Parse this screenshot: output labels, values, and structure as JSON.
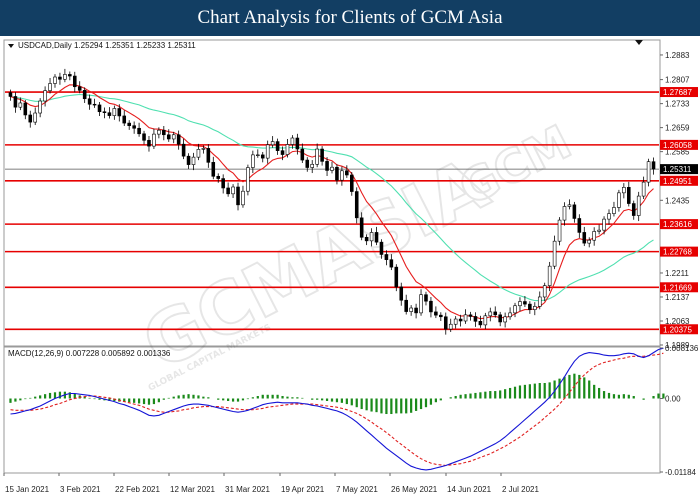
{
  "header": {
    "title": "Chart Analysis for Clients of GCM Asia"
  },
  "chart_data": [
    {
      "type": "candlestick",
      "symbol_label": "USDCAD,Daily  1.25294 1.25351 1.25233 1.25311",
      "ylim": [
        1.1989,
        1.2926
      ],
      "y_ticks": [
        1.2883,
        1.2807,
        1.2733,
        1.2659,
        1.2585,
        1.2435,
        1.2362,
        1.2211,
        1.2137,
        1.2063,
        1.1989
      ],
      "x_ticks": [
        "15 Jan 2021",
        "3 Feb 2021",
        "22 Feb 2021",
        "12 Mar 2021",
        "31 Mar 2021",
        "19 Apr 2021",
        "7 May 2021",
        "26 May 2021",
        "14 Jun 2021",
        "2 Jul 2021"
      ],
      "levels": [
        {
          "value": 1.27687,
          "label": "1.27687"
        },
        {
          "value": 1.26058,
          "label": "1.26058"
        },
        {
          "value": 1.24951,
          "label": "1.24951"
        },
        {
          "value": 1.23616,
          "label": "1.23616"
        },
        {
          "value": 1.22768,
          "label": "1.22768"
        },
        {
          "value": 1.21669,
          "label": "1.21669"
        },
        {
          "value": 1.20375,
          "label": "1.20375"
        }
      ],
      "current_price": {
        "value": 1.25311,
        "label": "1.25311"
      },
      "level_color": "#e60000",
      "fast_ma_color": "#e61e1e",
      "slow_ma_color": "#4fe0b0",
      "candle_up_color": "#000000",
      "candle_down_color": "#000000",
      "closes": [
        1.2755,
        1.2722,
        1.2735,
        1.2698,
        1.2676,
        1.2704,
        1.2741,
        1.2773,
        1.2795,
        1.2815,
        1.2808,
        1.2823,
        1.2818,
        1.2785,
        1.2774,
        1.2748,
        1.2731,
        1.2729,
        1.2708,
        1.2705,
        1.2696,
        1.2718,
        1.2695,
        1.2673,
        1.2665,
        1.2657,
        1.264,
        1.262,
        1.2602,
        1.2639,
        1.2651,
        1.2637,
        1.2624,
        1.2637,
        1.2608,
        1.2571,
        1.2545,
        1.2568,
        1.2592,
        1.2595,
        1.2552,
        1.2509,
        1.2502,
        1.2473,
        1.2455,
        1.2476,
        1.2421,
        1.2463,
        1.2536,
        1.2575,
        1.2575,
        1.2565,
        1.2606,
        1.2616,
        1.2588,
        1.2576,
        1.2607,
        1.2627,
        1.2593,
        1.2559,
        1.2536,
        1.2546,
        1.2593,
        1.2555,
        1.2527,
        1.2537,
        1.2497,
        1.2526,
        1.2513,
        1.2462,
        1.2381,
        1.2321,
        1.231,
        1.2336,
        1.2306,
        1.2268,
        1.2252,
        1.2229,
        1.2168,
        1.2127,
        1.2092,
        1.2103,
        1.2088,
        1.2144,
        1.2124,
        1.2091,
        1.2081,
        1.2076,
        1.2038,
        1.2053,
        1.2069,
        1.2063,
        1.2082,
        1.2077,
        1.2062,
        1.2051,
        1.2079,
        1.2091,
        1.2082,
        1.206,
        1.2076,
        1.2088,
        1.211,
        1.2123,
        1.2115,
        1.2098,
        1.2108,
        1.2137,
        1.2172,
        1.2232,
        1.2309,
        1.2374,
        1.2416,
        1.2421,
        1.2379,
        1.2336,
        1.2303,
        1.2312,
        1.2339,
        1.2343,
        1.2377,
        1.2394,
        1.2413,
        1.2458,
        1.2475,
        1.2425,
        1.2388,
        1.2448,
        1.2491,
        1.2554,
        1.2531
      ],
      "fast_ma": [
        1.2755,
        1.2749,
        1.2746,
        1.2738,
        1.2728,
        1.2724,
        1.2727,
        1.2736,
        1.2748,
        1.2762,
        1.2772,
        1.2783,
        1.2791,
        1.279,
        1.2787,
        1.278,
        1.2771,
        1.2763,
        1.2752,
        1.2743,
        1.2734,
        1.2731,
        1.2724,
        1.2714,
        1.2705,
        1.2696,
        1.2686,
        1.2673,
        1.2659,
        1.2655,
        1.2654,
        1.2651,
        1.2646,
        1.2644,
        1.2637,
        1.2626,
        1.2612,
        1.2604,
        1.2602,
        1.2601,
        1.2592,
        1.2577,
        1.2564,
        1.2546,
        1.2529,
        1.2519,
        1.2501,
        1.2492,
        1.25,
        1.2514,
        1.2525,
        1.2533,
        1.2546,
        1.2559,
        1.2564,
        1.2566,
        1.2575,
        1.2585,
        1.2587,
        1.2582,
        1.2573,
        1.2568,
        1.2573,
        1.2569,
        1.2561,
        1.2557,
        1.2544,
        1.254,
        1.2534,
        1.2517,
        1.249,
        1.2458,
        1.2431,
        1.2413,
        1.2393,
        1.2369,
        1.2348,
        1.2326,
        1.2295,
        1.2263,
        1.2231,
        1.2207,
        1.2184,
        1.2175,
        1.2163,
        1.2148,
        1.2133,
        1.212,
        1.2103,
        1.2092,
        1.2085,
        1.2078,
        1.2079,
        1.2079,
        1.2075,
        1.207,
        1.2072,
        1.2076,
        1.2077,
        1.2073,
        1.2074,
        1.2077,
        1.2085,
        1.2093,
        1.2098,
        1.2098,
        1.21,
        1.2108,
        1.212,
        1.2145,
        1.2181,
        1.2224,
        1.2265,
        1.2297,
        1.2312,
        1.2317,
        1.2313,
        1.2313,
        1.2319,
        1.2324,
        1.2336,
        1.235,
        1.2364,
        1.2384,
        1.2403,
        1.2407,
        1.2401,
        1.2413,
        1.2431,
        1.2457,
        1.2471
      ],
      "slow_ma": [
        1.2755,
        1.2752,
        1.275,
        1.2747,
        1.2743,
        1.274,
        1.274,
        1.2742,
        1.2745,
        1.2749,
        1.2752,
        1.2756,
        1.2758,
        1.276,
        1.2761,
        1.276,
        1.2759,
        1.2757,
        1.2755,
        1.2752,
        1.2749,
        1.2748,
        1.2745,
        1.2741,
        1.2737,
        1.2733,
        1.2729,
        1.2723,
        1.2717,
        1.2713,
        1.271,
        1.2706,
        1.2702,
        1.2699,
        1.2694,
        1.2688,
        1.268,
        1.2675,
        1.2671,
        1.2667,
        1.2661,
        1.2653,
        1.2646,
        1.2637,
        1.2628,
        1.262,
        1.261,
        1.2603,
        1.26,
        1.2599,
        1.2597,
        1.2596,
        1.2596,
        1.2597,
        1.2597,
        1.2596,
        1.2597,
        1.2598,
        1.2598,
        1.2596,
        1.2593,
        1.2591,
        1.2592,
        1.259,
        1.2587,
        1.2584,
        1.258,
        1.2577,
        1.2574,
        1.2569,
        1.2559,
        1.2548,
        1.2537,
        1.2528,
        1.2517,
        1.2505,
        1.2492,
        1.2479,
        1.2463,
        1.2446,
        1.2427,
        1.241,
        1.2393,
        1.238,
        1.2365,
        1.2349,
        1.2333,
        1.2317,
        1.23,
        1.2285,
        1.227,
        1.2256,
        1.2243,
        1.2231,
        1.2219,
        1.2206,
        1.2196,
        1.2186,
        1.2177,
        1.2167,
        1.2159,
        1.2152,
        1.2146,
        1.2141,
        1.2136,
        1.213,
        1.2126,
        1.2126,
        1.2127,
        1.2132,
        1.214,
        1.2151,
        1.2163,
        1.2175,
        1.2183,
        1.219,
        1.2195,
        1.22,
        1.2206,
        1.2212,
        1.222,
        1.2229,
        1.2238,
        1.2249,
        1.226,
        1.2267,
        1.2272,
        1.228,
        1.229,
        1.2303,
        1.2313
      ]
    },
    {
      "type": "macd",
      "indicator_label": "MACD(12,26,9) 0.007228 0.005892 0.001336",
      "ylim": [
        -0.01184,
        0.008136
      ],
      "y_ticks": [
        0.008136,
        0.0,
        -0.01184
      ],
      "y_tick_labels": [
        "0.008136",
        "0.00",
        "-0.01184"
      ],
      "macd_color": "#1515d6",
      "signal_color": "#e02020",
      "hist_color": "#1a8a1a",
      "macd": [
        -0.0025,
        -0.0024,
        -0.0022,
        -0.002,
        -0.0018,
        -0.0015,
        -0.0012,
        -0.0008,
        -0.0004,
        0.0,
        0.0003,
        0.0006,
        0.0008,
        0.0008,
        0.0007,
        0.0006,
        0.0005,
        0.0003,
        0.0001,
        -0.0001,
        -0.0003,
        -0.0005,
        -0.0008,
        -0.001,
        -0.0013,
        -0.0016,
        -0.0019,
        -0.0023,
        -0.0027,
        -0.0028,
        -0.0027,
        -0.0024,
        -0.0021,
        -0.0018,
        -0.0015,
        -0.0012,
        -0.001,
        -0.0009,
        -0.0009,
        -0.001,
        -0.0011,
        -0.0013,
        -0.0015,
        -0.0017,
        -0.0019,
        -0.0021,
        -0.0022,
        -0.0021,
        -0.0019,
        -0.0016,
        -0.0013,
        -0.001,
        -0.0008,
        -0.0007,
        -0.0006,
        -0.0007,
        -0.0007,
        -0.0007,
        -0.0007,
        -0.0008,
        -0.0009,
        -0.0011,
        -0.0012,
        -0.0014,
        -0.0016,
        -0.0018,
        -0.002,
        -0.0023,
        -0.0027,
        -0.0032,
        -0.0038,
        -0.0045,
        -0.0052,
        -0.0059,
        -0.0066,
        -0.0073,
        -0.008,
        -0.0086,
        -0.0092,
        -0.0098,
        -0.0104,
        -0.0109,
        -0.0112,
        -0.0114,
        -0.0115,
        -0.0114,
        -0.0112,
        -0.011,
        -0.0108,
        -0.0105,
        -0.0102,
        -0.0099,
        -0.0096,
        -0.0093,
        -0.0089,
        -0.0085,
        -0.0081,
        -0.0077,
        -0.0073,
        -0.0068,
        -0.0062,
        -0.0055,
        -0.0048,
        -0.0041,
        -0.0034,
        -0.0027,
        -0.002,
        -0.0013,
        -0.0006,
        0.0002,
        0.0012,
        0.0023,
        0.0035,
        0.0048,
        0.006,
        0.0068,
        0.0072,
        0.0074,
        0.0073,
        0.0072,
        0.007,
        0.0069,
        0.0069,
        0.007,
        0.0072,
        0.0073,
        0.0072,
        0.0068,
        0.0066,
        0.0069,
        0.0074,
        0.0079,
        0.0081
      ],
      "signal": [
        -0.0018,
        -0.0019,
        -0.0019,
        -0.0019,
        -0.0019,
        -0.0018,
        -0.0017,
        -0.0015,
        -0.0013,
        -0.001,
        -0.0008,
        -0.0005,
        -0.0002,
        0.0,
        0.0002,
        0.0003,
        0.0004,
        0.0004,
        0.0003,
        0.0002,
        0.0001,
        -0.0001,
        -0.0003,
        -0.0005,
        -0.0007,
        -0.0009,
        -0.0011,
        -0.0014,
        -0.0017,
        -0.0019,
        -0.0021,
        -0.0022,
        -0.0022,
        -0.0021,
        -0.002,
        -0.0018,
        -0.0017,
        -0.0015,
        -0.0014,
        -0.0013,
        -0.0013,
        -0.0013,
        -0.0013,
        -0.0014,
        -0.0015,
        -0.0016,
        -0.0017,
        -0.0018,
        -0.0018,
        -0.0018,
        -0.0017,
        -0.0016,
        -0.0014,
        -0.0013,
        -0.0012,
        -0.0011,
        -0.001,
        -0.0009,
        -0.0009,
        -0.0009,
        -0.0009,
        -0.0009,
        -0.001,
        -0.0011,
        -0.0012,
        -0.0013,
        -0.0014,
        -0.0016,
        -0.0018,
        -0.0021,
        -0.0024,
        -0.0028,
        -0.0033,
        -0.0038,
        -0.0044,
        -0.0049,
        -0.0055,
        -0.0061,
        -0.0068,
        -0.0074,
        -0.008,
        -0.0086,
        -0.0092,
        -0.0097,
        -0.0101,
        -0.0104,
        -0.0106,
        -0.0107,
        -0.0108,
        -0.0107,
        -0.0106,
        -0.0105,
        -0.0103,
        -0.0101,
        -0.0098,
        -0.0095,
        -0.0092,
        -0.0089,
        -0.0085,
        -0.0081,
        -0.0077,
        -0.0072,
        -0.0067,
        -0.0062,
        -0.0056,
        -0.005,
        -0.0044,
        -0.0038,
        -0.0031,
        -0.0024,
        -0.0017,
        -0.0009,
        0.0,
        0.001,
        0.002,
        0.003,
        0.0038,
        0.0045,
        0.0051,
        0.0055,
        0.0058,
        0.006,
        0.0062,
        0.0064,
        0.0065,
        0.0067,
        0.0068,
        0.0068,
        0.0068,
        0.0069,
        0.007,
        0.0071,
        0.0073
      ]
    }
  ],
  "watermark": {
    "brand": "GCMASIA",
    "subtitle": "GLOBAL CAPITAL MARKETS",
    "mark": "GCM"
  }
}
